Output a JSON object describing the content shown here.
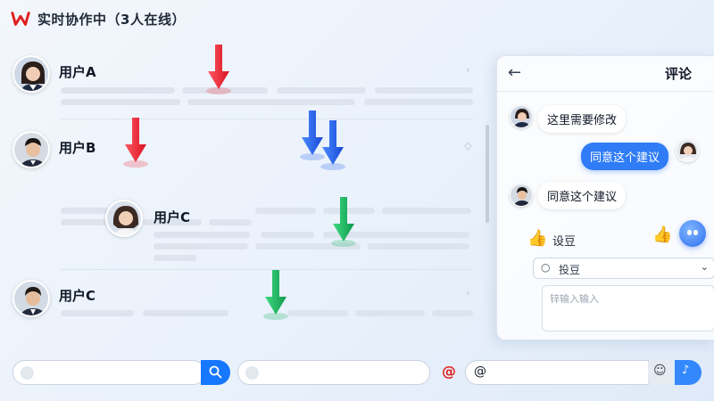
{
  "app": {
    "title": "实时协作中（3人在线）",
    "logo_icon": "wps-logo-icon",
    "brand_color": "#e02020"
  },
  "list": {
    "users": [
      {
        "name": "用户A"
      },
      {
        "name": "用户B"
      },
      {
        "name": "用户C"
      },
      {
        "name": "用户C"
      }
    ]
  },
  "cursor_colors": {
    "red": "#ee2b3b",
    "blue": "#2563eb",
    "green": "#16b35e"
  },
  "comments": {
    "title": "评论",
    "back_icon": "arrow-left-icon",
    "messages": [
      {
        "text": "这里需要修改",
        "side": "left"
      },
      {
        "text": "同意这个建议",
        "side": "right"
      },
      {
        "text": "同意这个建议",
        "side": "left"
      }
    ],
    "reaction_label": "设豆",
    "search_value": "投豆",
    "input_placeholder": "锌输入输入"
  },
  "bottom": {
    "at_red": "@",
    "at_main": "@"
  }
}
